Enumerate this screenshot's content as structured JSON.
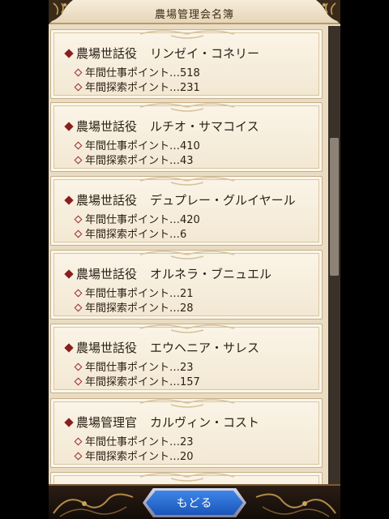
{
  "header": {
    "title": "農場管理会名簿"
  },
  "members": [
    {
      "role": "農場世話役",
      "name": "リンゼイ・コネリー",
      "work": "年間仕事ポイント…518",
      "explore": "年間探索ポイント…231"
    },
    {
      "role": "農場世話役",
      "name": "ルチオ・サマコイス",
      "work": "年間仕事ポイント…410",
      "explore": "年間探索ポイント…43"
    },
    {
      "role": "農場世話役",
      "name": "デュプレー・グルイヤール",
      "work": "年間仕事ポイント…420",
      "explore": "年間探索ポイント…6"
    },
    {
      "role": "農場世話役",
      "name": "オルネラ・ブニュエル",
      "work": "年間仕事ポイント…21",
      "explore": "年間探索ポイント…28"
    },
    {
      "role": "農場世話役",
      "name": "エウヘニア・サレス",
      "work": "年間仕事ポイント…23",
      "explore": "年間探索ポイント…157"
    },
    {
      "role": "農場管理官",
      "name": "カルヴィン・コスト",
      "work": "年間仕事ポイント…23",
      "explore": "年間探索ポイント…20"
    }
  ],
  "scroll": {
    "position_fraction": 0.35,
    "visible_fraction": 0.3
  },
  "footer": {
    "back_label": "もどる"
  },
  "colors": {
    "accent_red": "#8a1e1e",
    "button_blue": "#2a6fd6",
    "parchment": "#f5ecd9"
  }
}
